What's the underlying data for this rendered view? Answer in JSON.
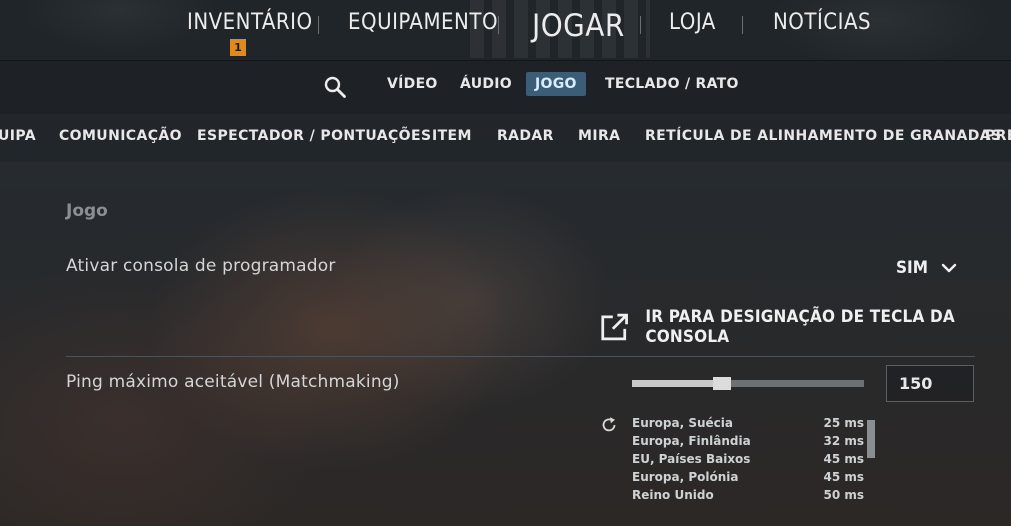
{
  "top_nav": {
    "items": [
      {
        "label": "INVENTÁRIO",
        "badge": "1"
      },
      {
        "label": "EQUIPAMENTO"
      },
      {
        "label": "JOGAR"
      },
      {
        "label": "LOJA"
      },
      {
        "label": "NOTÍCIAS"
      }
    ]
  },
  "settings_tabs": {
    "search_icon": "search-icon",
    "items": [
      "VÍDEO",
      "ÁUDIO",
      "JOGO",
      "TECLADO / RATO"
    ],
    "active": "JOGO",
    "active_color": "#3b5d78"
  },
  "categories": [
    "UIPA",
    "COMUNICAÇÃO",
    "ESPECTADOR / PONTUAÇÕES",
    "ITEM",
    "RADAR",
    "MIRA",
    "RETÍCULA DE ALINHAMENTO DE GRANADAS",
    "PRE"
  ],
  "section": {
    "title": "Jogo"
  },
  "dev_console": {
    "label": "Ativar consola de programador",
    "value": "SIM",
    "icon": "chevron-down-icon"
  },
  "console_link": {
    "label": "IR PARA DESIGNAÇÃO DE TECLA DA CONSOLA",
    "icon": "external-link-icon"
  },
  "max_ping": {
    "label": "Ping máximo aceitável (Matchmaking)",
    "value": "150",
    "slider_fraction": 0.39
  },
  "servers": {
    "refresh_icon": "refresh-icon",
    "rows": [
      {
        "name": "Europa, Suécia",
        "ping": "25 ms"
      },
      {
        "name": "Europa, Finlândia",
        "ping": "32 ms"
      },
      {
        "name": "EU, Países Baixos",
        "ping": "45 ms"
      },
      {
        "name": "Europa, Polónia",
        "ping": "45 ms"
      },
      {
        "name": "Reino Unido",
        "ping": "50 ms"
      }
    ]
  },
  "colors": {
    "badge": "#e08a1d",
    "active_tab": "#3b5d78"
  }
}
